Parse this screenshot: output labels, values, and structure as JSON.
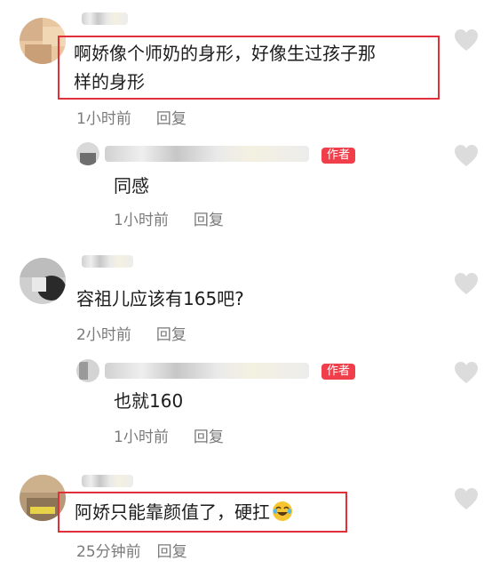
{
  "comments": [
    {
      "text_line1": "啊娇像个师奶的身形，好像生过孩子那",
      "text_line2": "样的身形",
      "time": "1小时前",
      "reply": "回复",
      "reply_thread": {
        "badge": "作者",
        "text": "同感",
        "time": "1小时前",
        "reply": "回复"
      }
    },
    {
      "text": "容祖儿应该有165吧?",
      "time": "2小时前",
      "reply": "回复",
      "reply_thread": {
        "badge": "作者",
        "text": "也就160",
        "time": "1小时前",
        "reply": "回复"
      }
    },
    {
      "text": "阿娇只能靠颜值了，硬扛",
      "emoji": "rolling-on-floor-laughing-emoji",
      "time": "25分钟前",
      "reply": "回复"
    }
  ],
  "colors": {
    "highlight": "#e0313b",
    "badge_bg": "#f03e4b",
    "meta_text": "#7a7a7a",
    "heart": "#dcdcdc"
  },
  "icons": {
    "like": "heart-icon"
  }
}
